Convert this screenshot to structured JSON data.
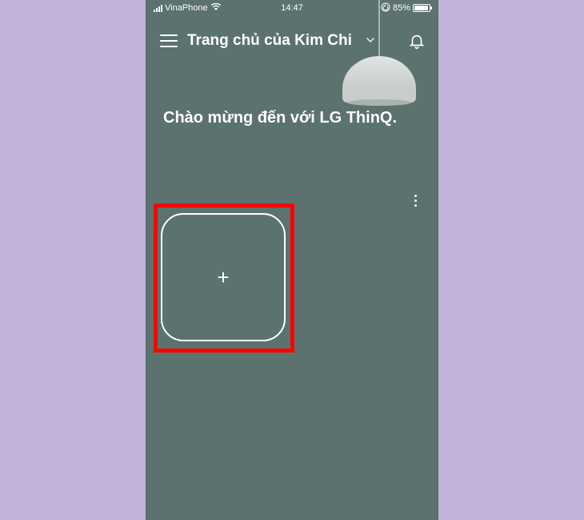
{
  "status_bar": {
    "carrier": "VinaPhone",
    "time": "14:47",
    "battery_percent": "85%"
  },
  "header": {
    "title": "Trang chủ của Kim Chi"
  },
  "main": {
    "welcome_text": "Chào mừng đến với LG ThinQ."
  },
  "icons": {
    "plus": "+"
  }
}
